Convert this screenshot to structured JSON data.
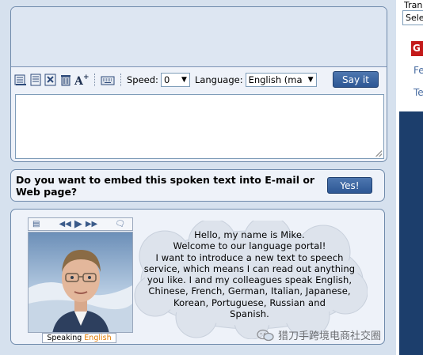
{
  "toolbar": {
    "icons": [
      "document-icon",
      "notepad-icon",
      "excel-icon",
      "trash-icon",
      "font-size-icon",
      "keyboard-icon"
    ],
    "speed_label": "Speed:",
    "speed_value": "0",
    "language_label": "Language:",
    "language_value": "English (ma",
    "say_it_label": "Say it"
  },
  "text_area": {
    "value": ""
  },
  "embed": {
    "question": "Do you want to embed this spoken text into E-mail or Web page?",
    "yes_label": "Yes!"
  },
  "avatar": {
    "speaking_label": "Speaking",
    "speaking_language": "English",
    "speech_lines": [
      "Hello, my name is Mike.",
      "Welcome to our language portal!",
      "I want to introduce a new text to speech",
      "service, which means I can read out anything",
      "you like. I and my colleagues speak English,",
      "Chinese, French, German, Italian, Japanese,",
      "Korean, Portuguese, Russian and",
      "Spanish."
    ]
  },
  "sidebar": {
    "translate_label": "Tran",
    "select_value": "Sele",
    "badge_text": "G",
    "link1": "Fe",
    "link2": "Te"
  },
  "watermark": {
    "text": "猎刀手跨境电商社交圈"
  },
  "colors": {
    "button_blue": "#2d5794",
    "panel_border": "#6f8aab",
    "sidebar_dark": "#1c3e6c",
    "badge_red": "#c31a1a",
    "speaking_language": "#e07a00"
  }
}
